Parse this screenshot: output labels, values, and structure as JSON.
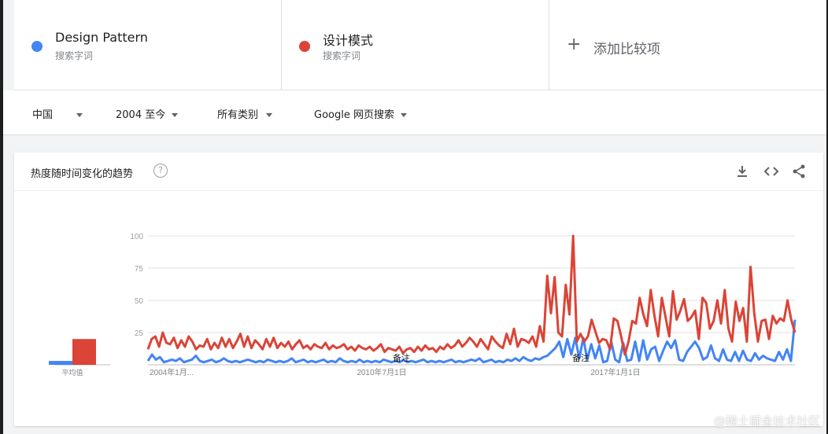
{
  "terms": [
    {
      "name": "Design Pattern",
      "sub": "搜索字词",
      "color": "#4285f4"
    },
    {
      "name": "设计模式",
      "sub": "搜索字词",
      "color": "#db4437"
    }
  ],
  "add_term": {
    "icon": "plus-icon",
    "label": "添加比较项"
  },
  "filters": {
    "region": "中国",
    "time": "2004 至今",
    "category": "所有类别",
    "search_type": "Google 网页搜索"
  },
  "card": {
    "title": "热度随时间变化的趋势",
    "actions": [
      "download-icon",
      "embed-icon",
      "share-icon"
    ]
  },
  "watermark": "@稀土掘金技术社区",
  "chart_data": {
    "type": "line",
    "ylim": [
      0,
      100
    ],
    "yticks": [
      "100",
      "75",
      "50",
      "25"
    ],
    "xticks": [
      "2004年1月...",
      "2010年7月1日",
      "2017年1月1日"
    ],
    "annotations": [
      "备注",
      "备注"
    ],
    "average_label": "平均值",
    "averages": [
      {
        "name": "Design Pattern",
        "value": 3,
        "color": "#4285f4"
      },
      {
        "name": "设计模式",
        "value": 20,
        "color": "#db4437"
      }
    ],
    "series": [
      {
        "name": "Design Pattern",
        "color": "#4285f4",
        "values": [
          3,
          8,
          4,
          6,
          2,
          3,
          4,
          3,
          5,
          2,
          3,
          4,
          7,
          3,
          2,
          3,
          4,
          2,
          3,
          5,
          3,
          2,
          3,
          2,
          3,
          4,
          3,
          2,
          3,
          2,
          4,
          3,
          2,
          3,
          2,
          3,
          5,
          2,
          3,
          4,
          2,
          3,
          2,
          3,
          4,
          2,
          3,
          2,
          5,
          3,
          2,
          3,
          2,
          4,
          2,
          3,
          2,
          3,
          2,
          4,
          3,
          2,
          3,
          2,
          4,
          2,
          3,
          2,
          3,
          4,
          2,
          3,
          2,
          3,
          2,
          3,
          4,
          2,
          3,
          2,
          3,
          4,
          3,
          5,
          2,
          3,
          4,
          2,
          3,
          2,
          4,
          3,
          5,
          3,
          6,
          4,
          3,
          5,
          4,
          6,
          7,
          10,
          13,
          18,
          6,
          20,
          8,
          21,
          5,
          21,
          4,
          16,
          5,
          15,
          2,
          3,
          18,
          4,
          2,
          17,
          3,
          4,
          18,
          3,
          19,
          4,
          12,
          14,
          3,
          11,
          18,
          13,
          19,
          4,
          3,
          10,
          14,
          18,
          13,
          4,
          6,
          15,
          5,
          3,
          12,
          4,
          3,
          10,
          3,
          11,
          4,
          3,
          9,
          4,
          7,
          5,
          4,
          3,
          10,
          4,
          12,
          3,
          35
        ]
      },
      {
        "name": "设计模式",
        "color": "#db4437",
        "values": [
          12,
          20,
          22,
          14,
          25,
          17,
          16,
          21,
          13,
          19,
          14,
          22,
          18,
          12,
          15,
          14,
          20,
          12,
          17,
          13,
          21,
          14,
          20,
          13,
          18,
          24,
          14,
          22,
          13,
          19,
          16,
          12,
          20,
          14,
          21,
          13,
          17,
          14,
          18,
          12,
          16,
          19,
          13,
          15,
          12,
          16,
          14,
          13,
          17,
          12,
          15,
          13,
          14,
          16,
          12,
          14,
          11,
          15,
          13,
          12,
          14,
          11,
          13,
          16,
          10,
          13,
          12,
          11,
          14,
          9,
          12,
          13,
          10,
          14,
          11,
          15,
          12,
          13,
          10,
          14,
          12,
          16,
          13,
          15,
          19,
          14,
          17,
          21,
          18,
          14,
          20,
          16,
          12,
          22,
          18,
          15,
          13,
          24,
          16,
          28,
          14,
          20,
          19,
          17,
          22,
          14,
          30,
          18,
          69,
          40,
          68,
          25,
          22,
          62,
          39,
          100,
          18,
          24,
          18,
          22,
          35,
          26,
          17,
          20,
          19,
          12,
          36,
          34,
          22,
          8,
          18,
          34,
          32,
          52,
          39,
          30,
          58,
          38,
          22,
          52,
          37,
          22,
          57,
          35,
          42,
          51,
          34,
          37,
          42,
          20,
          52,
          48,
          28,
          34,
          50,
          32,
          58,
          28,
          18,
          49,
          34,
          44,
          18,
          76,
          40,
          18,
          34,
          35,
          20,
          38,
          32,
          36,
          34,
          50,
          35,
          25
        ]
      }
    ]
  }
}
